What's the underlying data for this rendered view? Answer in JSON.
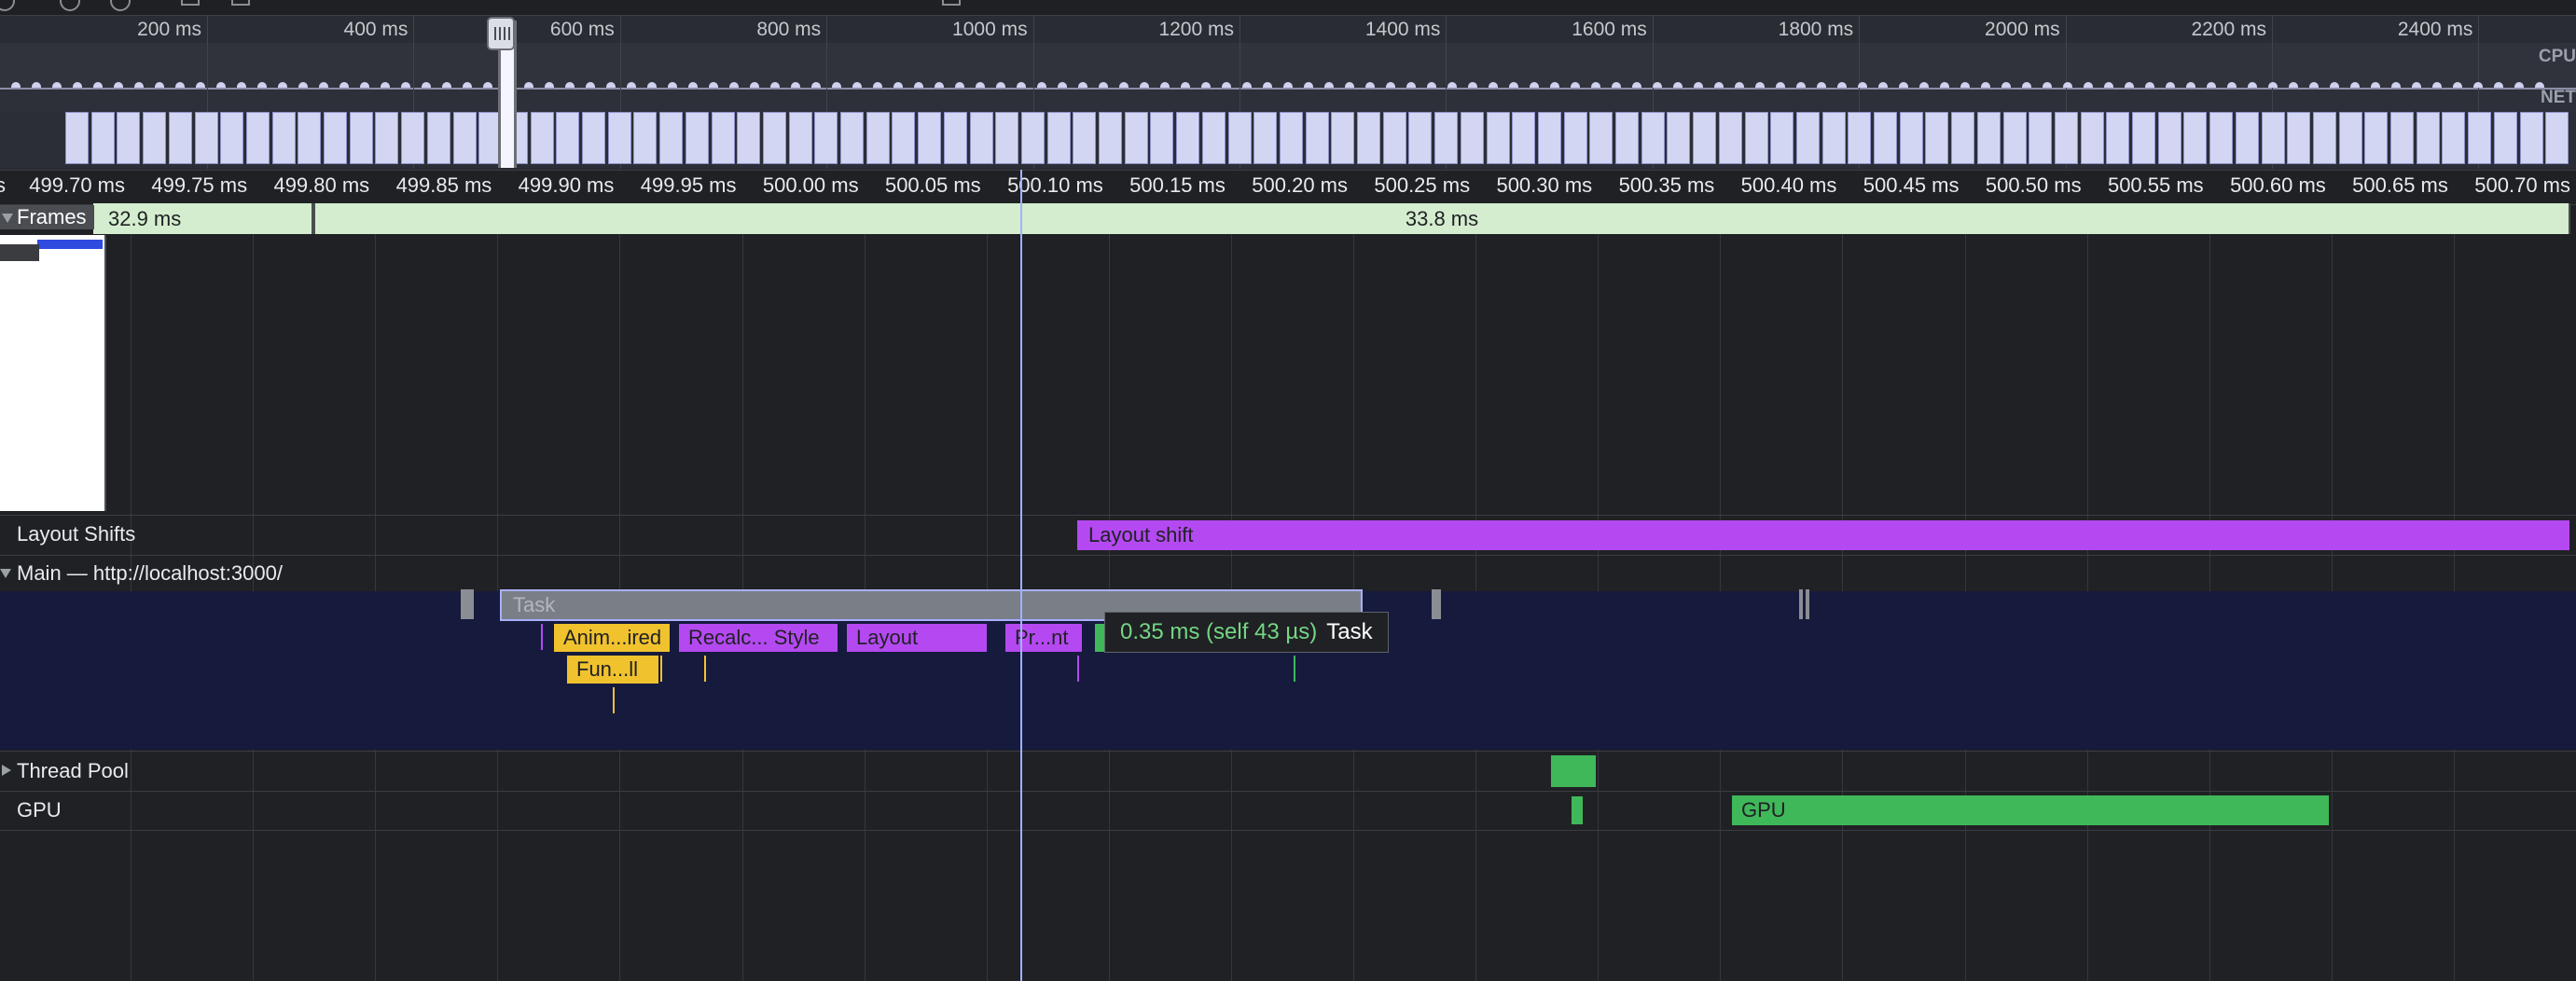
{
  "overview": {
    "ticks": [
      "200 ms",
      "400 ms",
      "600 ms",
      "800 ms",
      "1000 ms",
      "1200 ms",
      "1400 ms",
      "1600 ms",
      "1800 ms",
      "2000 ms",
      "2200 ms",
      "2400 ms"
    ],
    "cpu_label": "CPU",
    "net_label": "NET"
  },
  "detail_ruler": {
    "ticks": [
      "s",
      "499.70 ms",
      "499.75 ms",
      "499.80 ms",
      "499.85 ms",
      "499.90 ms",
      "499.95 ms",
      "500.00 ms",
      "500.05 ms",
      "500.10 ms",
      "500.15 ms",
      "500.20 ms",
      "500.25 ms",
      "500.30 ms",
      "500.35 ms",
      "500.40 ms",
      "500.45 ms",
      "500.50 ms",
      "500.55 ms",
      "500.60 ms",
      "500.65 ms",
      "500.70 ms"
    ]
  },
  "frames": {
    "label": "Frames",
    "items": [
      "32.9 ms",
      "33.8 ms"
    ]
  },
  "tracks": {
    "layout_shifts": {
      "label": "Layout Shifts",
      "bar_label": "Layout shift"
    },
    "main": {
      "label": "Main — http://localhost:3000/",
      "task_label": "Task",
      "events_row1": [
        "Anim...ired",
        "Recalc... Style",
        "Layout",
        "Pr...nt"
      ],
      "events_row2": [
        "Fun...ll"
      ]
    },
    "thread_pool": {
      "label": "Thread Pool"
    },
    "gpu": {
      "label": "GPU",
      "bar_label": "GPU"
    }
  },
  "tooltip": {
    "duration": "0.35 ms (self 43 µs)",
    "name": "Task"
  },
  "colors": {
    "scripting": "#f0c22d",
    "rendering": "#b449f1",
    "painting": "#3fb85a",
    "frames": "#d4edce",
    "main_bg": "#161a3d"
  }
}
